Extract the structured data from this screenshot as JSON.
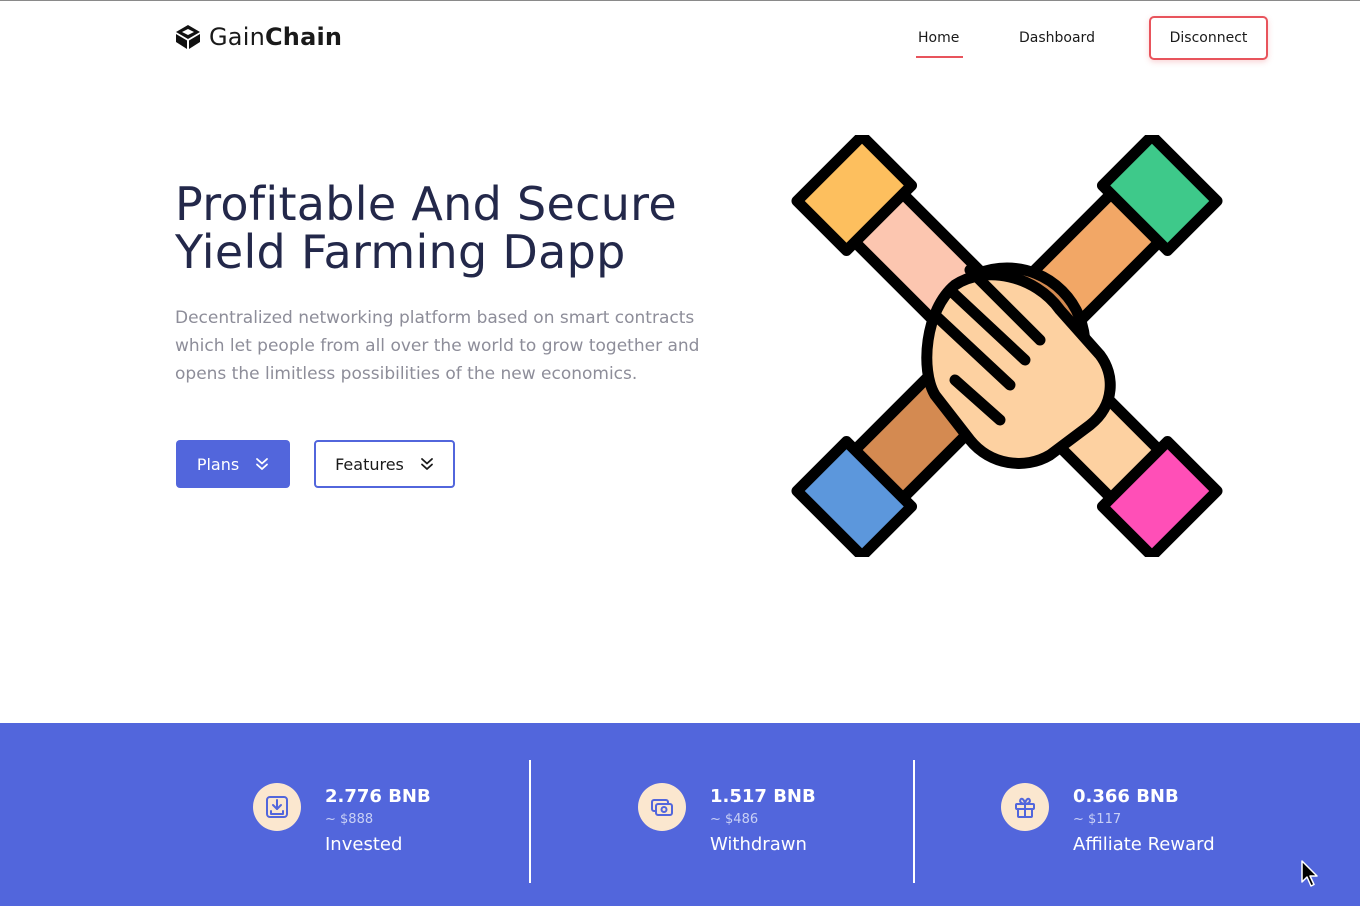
{
  "brand": {
    "name_light": "Gain",
    "name_bold": "Chain",
    "logo_icon": "cube-logo-icon"
  },
  "nav": {
    "items": [
      {
        "label": "Home",
        "active": true
      },
      {
        "label": "Dashboard",
        "active": false
      }
    ],
    "disconnect_label": "Disconnect"
  },
  "hero": {
    "title_line1": "Profitable And Secure",
    "title_line2": "Yield Farming Dapp",
    "description": "Decentralized networking platform based on smart contracts which let people from all over the world to grow together and opens the limitless possibilities of the new economics.",
    "plans_label": "Plans",
    "features_label": "Features",
    "button_icon": "double-chevron-down-icon",
    "illustration_icon": "stacked-hands-teamwork-icon"
  },
  "stats": [
    {
      "value": "2.776 BNB",
      "usd": "~ $888",
      "label": "Invested",
      "icon": "download-tray-icon"
    },
    {
      "value": "1.517 BNB",
      "usd": "~ $486",
      "label": "Withdrawn",
      "icon": "cash-stack-icon"
    },
    {
      "value": "0.366 BNB",
      "usd": "~ $117",
      "label": "Affiliate Reward",
      "icon": "gift-icon"
    }
  ],
  "colors": {
    "accent_blue": "#5266dc",
    "accent_red": "#e8545c",
    "heading": "#23284a",
    "muted_text": "#8d8d99",
    "stat_icon_bg": "#fbe7cf"
  }
}
